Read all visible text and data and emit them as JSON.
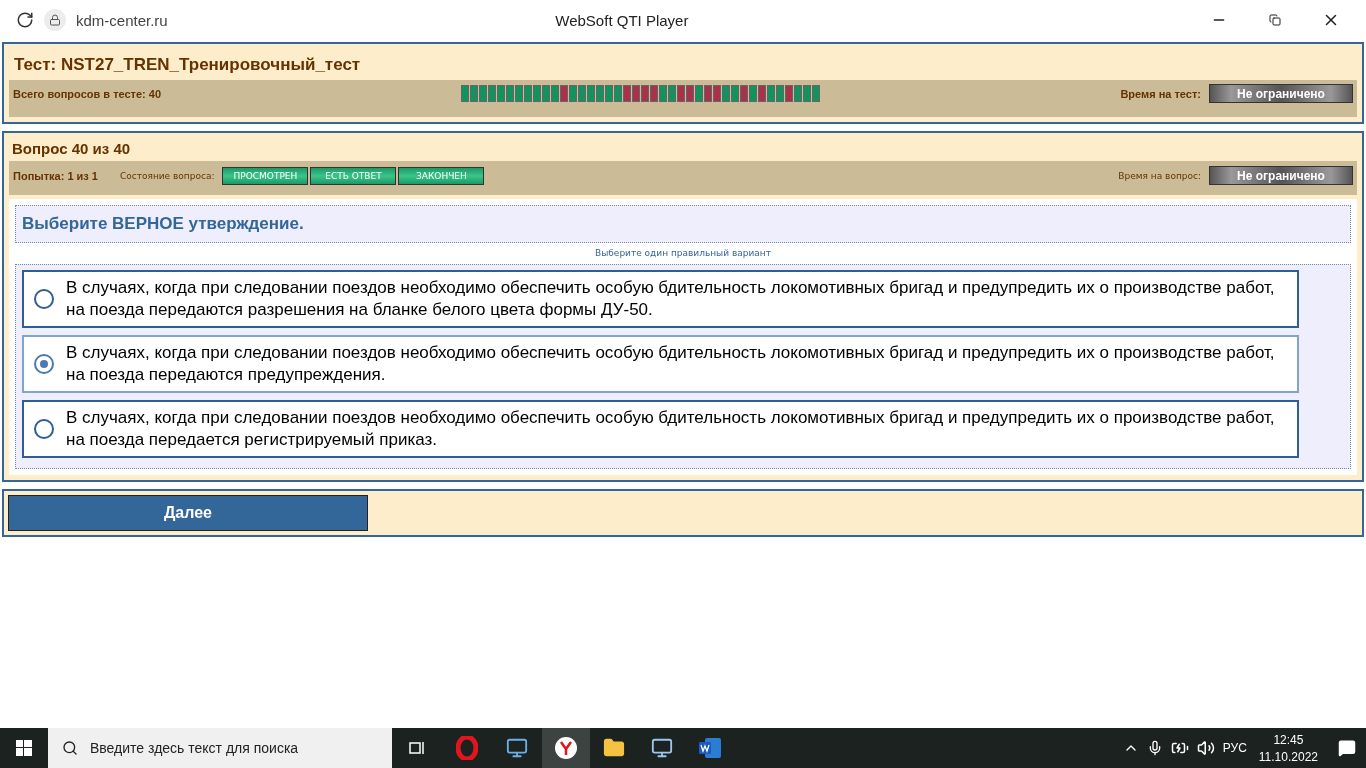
{
  "browser": {
    "address": "kdm-center.ru",
    "title": "WebSoft QTI Player"
  },
  "test": {
    "title": "Тест: NST27_TREN_Тренировочный_тест",
    "total_label": "Всего вопросов в тесте: 40",
    "time_label": "Время на тест:",
    "time_value": "Не ограничено",
    "progress": [
      {
        "color": "#12925e"
      },
      {
        "color": "#12925e"
      },
      {
        "color": "#12925e"
      },
      {
        "color": "#12925e"
      },
      {
        "color": "#12925e"
      },
      {
        "color": "#12925e"
      },
      {
        "color": "#12925e"
      },
      {
        "color": "#12925e"
      },
      {
        "color": "#12925e"
      },
      {
        "color": "#12925e"
      },
      {
        "color": "#12925e"
      },
      {
        "color": "#a8324a"
      },
      {
        "color": "#12925e"
      },
      {
        "color": "#12925e"
      },
      {
        "color": "#12925e"
      },
      {
        "color": "#12925e"
      },
      {
        "color": "#12925e"
      },
      {
        "color": "#12925e"
      },
      {
        "color": "#a8324a"
      },
      {
        "color": "#a8324a"
      },
      {
        "color": "#a8324a"
      },
      {
        "color": "#a8324a"
      },
      {
        "color": "#12925e"
      },
      {
        "color": "#12925e"
      },
      {
        "color": "#a8324a"
      },
      {
        "color": "#a8324a"
      },
      {
        "color": "#12925e"
      },
      {
        "color": "#a8324a"
      },
      {
        "color": "#a8324a"
      },
      {
        "color": "#12925e"
      },
      {
        "color": "#12925e"
      },
      {
        "color": "#a8324a"
      },
      {
        "color": "#12925e"
      },
      {
        "color": "#a8324a"
      },
      {
        "color": "#12925e"
      },
      {
        "color": "#12925e"
      },
      {
        "color": "#a8324a"
      },
      {
        "color": "#12925e"
      },
      {
        "color": "#12925e"
      },
      {
        "color": "#12925e"
      }
    ]
  },
  "question": {
    "title": "Вопрос 40 из 40",
    "attempt": "Попытка: 1 из 1",
    "state_label": "Состояние вопроса:",
    "states": [
      "ПРОСМОТРЕН",
      "ЕСТЬ ОТВЕТ",
      "ЗАКОНЧЕН"
    ],
    "time_label": "Время на вопрос:",
    "time_value": "Не ограничено",
    "prompt": "Выберите ВЕРНОЕ утверждение.",
    "hint": "Выберите один правильный вариант",
    "options": [
      {
        "text": "В случаях, когда при следовании поездов необходимо обеспечить особую бдительность локомотивных бригад и предупредить их о производстве работ, на поезда передаются разрешения на бланке белого цвета формы ДУ-50.",
        "selected": false
      },
      {
        "text": "В случаях, когда при следовании поездов необходимо обеспечить особую бдительность локомотивных бригад и предупредить их о производстве работ, на поезда передаются предупреждения.",
        "selected": true
      },
      {
        "text": "В случаях, когда при следовании поездов необходимо обеспечить особую бдительность локомотивных бригад и предупредить их о производстве работ, на поезда передается регистрируемый приказ.",
        "selected": false
      }
    ]
  },
  "next_button": "Далее",
  "taskbar": {
    "search_placeholder": "Введите здесь текст для поиска",
    "language": "РУС",
    "time": "12:45",
    "date": "11.10.2022"
  }
}
